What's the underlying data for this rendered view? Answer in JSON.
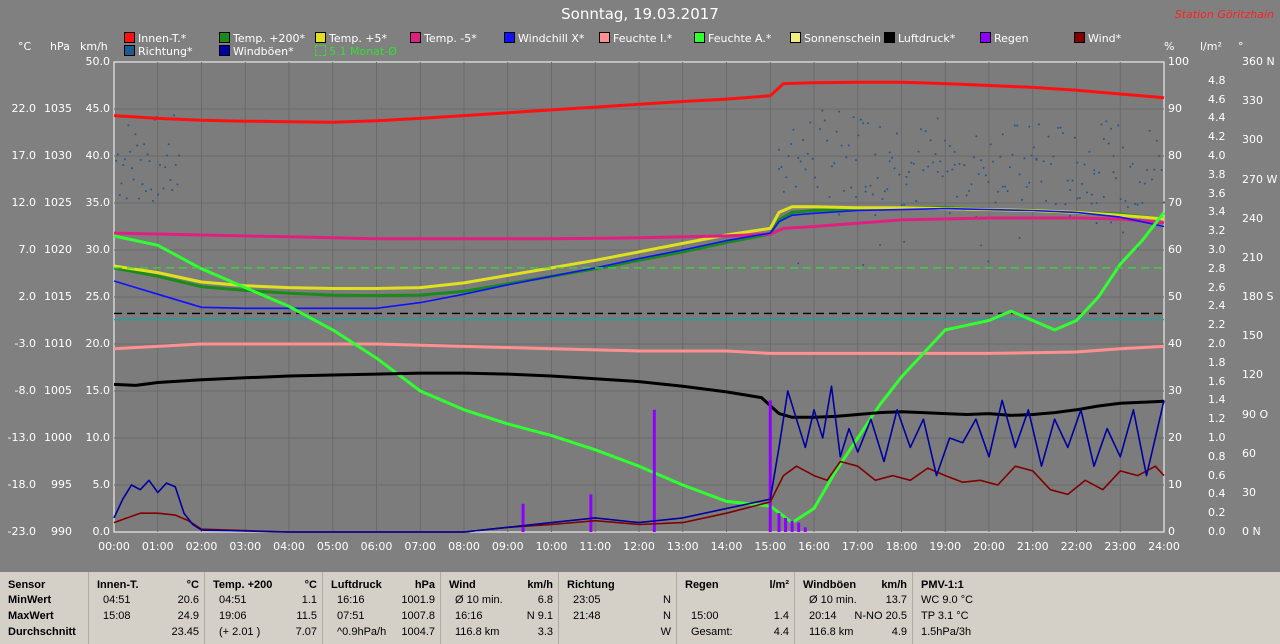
{
  "header": {
    "title": "Sonntag, 19.03.2017",
    "station": "Station Göritzhain"
  },
  "legend": [
    {
      "label": "Innen-T.*",
      "color": "#ff1010"
    },
    {
      "label": "Temp. +200*",
      "color": "#1a8a1a"
    },
    {
      "label": "Temp. +5*",
      "color": "#e0e020"
    },
    {
      "label": "Temp. -5*",
      "color": "#e02080"
    },
    {
      "label": "Windchill X*",
      "color": "#1010ff"
    },
    {
      "label": "Feuchte I.*",
      "color": "#ff9090"
    },
    {
      "label": "Feuchte A.*",
      "color": "#30ff30"
    },
    {
      "label": "Sonnenschein",
      "color": "#f0f080"
    },
    {
      "label": "Luftdruck*",
      "color": "#000000"
    },
    {
      "label": "Regen",
      "color": "#9000ff"
    },
    {
      "label": "Wind*",
      "color": "#800000"
    },
    {
      "label": "Richtung*",
      "color": "#205890"
    },
    {
      "label": "Windböen*",
      "color": "#0000a0"
    },
    {
      "label": "5.1 Monat-Ø",
      "color": "#30e030"
    }
  ],
  "units": {
    "c": "°C",
    "hpa": "hPa",
    "kmh": "km/h",
    "pct": "%",
    "lm2": "l/m²",
    "deg": "°"
  },
  "axes": {
    "temp_ticks": [
      "22.0",
      "17.0",
      "12.0",
      "7.0",
      "2.0",
      "-3.0",
      "-8.0",
      "-13.0",
      "-18.0",
      "-23.0"
    ],
    "hpa_ticks": [
      "1035",
      "1030",
      "1025",
      "1020",
      "1015",
      "1010",
      "1005",
      "1000",
      "995",
      "990"
    ],
    "kmh_ticks": [
      "50.0",
      "45.0",
      "40.0",
      "35.0",
      "30.0",
      "25.0",
      "20.0",
      "15.0",
      "10.0",
      "5.0",
      "0.0"
    ],
    "pct_ticks": [
      "100",
      "90",
      "80",
      "70",
      "60",
      "50",
      "40",
      "30",
      "20",
      "10",
      "0"
    ],
    "rain_ticks": [
      "4.8",
      "4.6",
      "4.4",
      "4.2",
      "4.0",
      "3.8",
      "3.6",
      "3.4",
      "3.2",
      "3.0",
      "2.8",
      "2.6",
      "2.4",
      "2.2",
      "2.0",
      "1.8",
      "1.6",
      "1.4",
      "1.2",
      "1.0",
      "0.8",
      "0.6",
      "0.4",
      "0.2",
      "0.0"
    ],
    "deg_ticks": [
      "360 N",
      "330",
      "300",
      "270 W",
      "240",
      "210",
      "180 S",
      "150",
      "120",
      "90 O",
      "60",
      "30",
      "0 N"
    ],
    "x_ticks": [
      "00:00",
      "01:00",
      "02:00",
      "03:00",
      "04:00",
      "05:00",
      "06:00",
      "07:00",
      "08:00",
      "09:00",
      "10:00",
      "11:00",
      "12:00",
      "13:00",
      "14:00",
      "15:00",
      "16:00",
      "17:00",
      "18:00",
      "19:00",
      "20:00",
      "21:00",
      "22:00",
      "23:00",
      "24:00"
    ]
  },
  "chart_data": {
    "type": "line",
    "x_unit": "hour",
    "series": [
      {
        "name": "Innen-T.*",
        "color": "#ff1010",
        "axis": "temp",
        "x": [
          0,
          1,
          2,
          3,
          4,
          5,
          6,
          7,
          8,
          9,
          10,
          11,
          12,
          13,
          14,
          15,
          15.3,
          16,
          17,
          18,
          19,
          20,
          21,
          22,
          23,
          24
        ],
        "values": [
          21.3,
          21.0,
          20.8,
          20.7,
          20.65,
          20.6,
          20.75,
          21.0,
          21.3,
          21.6,
          21.9,
          22.2,
          22.5,
          22.8,
          23.05,
          23.4,
          24.7,
          24.8,
          24.85,
          24.85,
          24.7,
          24.5,
          24.3,
          24.0,
          23.6,
          23.2
        ]
      },
      {
        "name": "Temp. +200*",
        "color": "#1a8a1a",
        "axis": "temp",
        "x": [
          0,
          1,
          2,
          3,
          4,
          5,
          6,
          7,
          8,
          9,
          10,
          11,
          12,
          13,
          14,
          15,
          15.2,
          15.5,
          16,
          17,
          18,
          19,
          20,
          21,
          22,
          23,
          24
        ],
        "values": [
          5.1,
          4.2,
          3.1,
          2.7,
          2.4,
          2.2,
          2.15,
          2.2,
          2.6,
          3.4,
          4.2,
          5.0,
          5.9,
          6.8,
          7.8,
          8.7,
          10.2,
          11.0,
          11.2,
          11.4,
          11.5,
          11.5,
          11.3,
          11.2,
          11.0,
          10.8,
          10.3
        ]
      },
      {
        "name": "Temp. +5*",
        "color": "#e0e020",
        "axis": "temp",
        "x": [
          0,
          1,
          2,
          3,
          4,
          5,
          6,
          7,
          8,
          9,
          10,
          11,
          12,
          13,
          14,
          15,
          15.2,
          15.5,
          16,
          17,
          18,
          19,
          20,
          21,
          22,
          23,
          24
        ],
        "values": [
          5.3,
          4.6,
          3.6,
          3.2,
          3.0,
          2.9,
          2.9,
          3.0,
          3.5,
          4.3,
          5.1,
          5.9,
          6.8,
          7.7,
          8.6,
          9.3,
          11.0,
          11.6,
          11.6,
          11.5,
          11.5,
          11.4,
          11.3,
          11.2,
          11.0,
          10.7,
          10.3
        ]
      },
      {
        "name": "Temp. -5*",
        "color": "#e02080",
        "axis": "temp",
        "x": [
          0,
          2,
          4,
          6,
          8,
          10,
          12,
          14,
          15,
          15.3,
          16,
          18,
          20,
          22,
          23,
          24
        ],
        "values": [
          8.8,
          8.6,
          8.4,
          8.2,
          8.2,
          8.2,
          8.3,
          8.5,
          8.7,
          9.3,
          9.5,
          10.2,
          10.4,
          10.4,
          10.3,
          9.9
        ]
      },
      {
        "name": "Windchill X*",
        "color": "#1010ff",
        "axis": "temp",
        "x": [
          0,
          1,
          2,
          3,
          4,
          5,
          6,
          7,
          8,
          9,
          10,
          11,
          12,
          13,
          14,
          15,
          15.2,
          15.5,
          16,
          17,
          18,
          19,
          20,
          21,
          22,
          23,
          24
        ],
        "values": [
          3.7,
          2.3,
          0.9,
          0.8,
          0.8,
          0.8,
          0.8,
          1.4,
          2.3,
          3.3,
          4.2,
          5.1,
          6.1,
          7.0,
          8.0,
          8.8,
          10.0,
          10.7,
          10.9,
          11.2,
          11.3,
          11.4,
          11.3,
          11.2,
          11.0,
          10.5,
          9.5
        ]
      },
      {
        "name": "Feuchte I.*",
        "color": "#ff9090",
        "axis": "pct",
        "x": [
          0,
          2,
          4,
          6,
          8,
          10,
          12,
          14,
          15,
          16,
          18,
          20,
          22,
          23,
          24
        ],
        "values": [
          39,
          40,
          40,
          40,
          39.5,
          39,
          38.5,
          38.5,
          38,
          38,
          38,
          38,
          38.3,
          39,
          39.5
        ]
      },
      {
        "name": "Feuchte A.*",
        "color": "#30ff30",
        "axis": "pct",
        "x": [
          0,
          1,
          2,
          3,
          4,
          5,
          6,
          7,
          8,
          9,
          10,
          11,
          12,
          13,
          14,
          15,
          15.5,
          16,
          16.5,
          17,
          17.5,
          18,
          18.5,
          19,
          19.5,
          20,
          20.5,
          21,
          21.5,
          22,
          22.5,
          23,
          23.5,
          24
        ],
        "values": [
          63,
          61,
          56,
          52,
          48,
          43,
          37,
          30,
          26,
          23,
          20.5,
          17.5,
          14,
          10,
          6.5,
          5.5,
          2,
          5,
          13,
          20,
          27,
          33,
          38,
          43,
          44,
          45,
          47,
          45,
          43,
          45,
          50,
          57,
          62,
          68
        ]
      },
      {
        "name": "Luftdruck*",
        "color": "#000000",
        "axis": "hpa",
        "x": [
          0,
          0.5,
          1,
          2,
          3,
          4,
          5,
          6,
          7,
          8,
          9,
          10,
          11,
          12,
          13,
          14,
          14.8,
          15.2,
          15.5,
          16,
          16.5,
          17,
          17.5,
          18,
          18.5,
          19,
          19.5,
          20,
          20.5,
          21,
          21.5,
          22,
          22.5,
          23,
          23.5,
          24
        ],
        "values": [
          1005.7,
          1005.6,
          1005.9,
          1006.2,
          1006.4,
          1006.6,
          1006.7,
          1006.8,
          1006.9,
          1006.9,
          1006.8,
          1006.6,
          1006.3,
          1006.0,
          1005.5,
          1004.9,
          1004.3,
          1002.6,
          1002.2,
          1002.2,
          1002.3,
          1002.5,
          1002.7,
          1002.8,
          1002.7,
          1002.6,
          1002.5,
          1002.6,
          1002.4,
          1002.5,
          1002.7,
          1003.0,
          1003.4,
          1003.7,
          1003.8,
          1003.9
        ]
      },
      {
        "name": "Regen",
        "color": "#9000ff",
        "axis": "rain",
        "type": "bar",
        "x": [
          9.35,
          10.9,
          12.35,
          15.0,
          15.2,
          15.35,
          15.5,
          15.65,
          15.8
        ],
        "values": [
          0.3,
          0.4,
          1.3,
          1.4,
          0.2,
          0.15,
          0.12,
          0.1,
          0.05
        ]
      },
      {
        "name": "Wind*",
        "color": "#800000",
        "axis": "kmh",
        "x": [
          0,
          0.3,
          0.6,
          1,
          1.4,
          1.7,
          2,
          4,
          6,
          8,
          9,
          10,
          11,
          12,
          13,
          14,
          15,
          15.3,
          15.6,
          16,
          16.3,
          16.6,
          17,
          17.4,
          17.8,
          18.2,
          18.6,
          19,
          19.4,
          19.8,
          20.2,
          20.6,
          21,
          21.4,
          21.8,
          22.2,
          22.6,
          23,
          23.4,
          23.8,
          24
        ],
        "values": [
          1.0,
          1.5,
          2.0,
          2.0,
          1.8,
          1.2,
          0.3,
          0,
          0,
          0,
          0.5,
          0.8,
          1.2,
          0.8,
          1.0,
          2.0,
          3.2,
          6.0,
          7.0,
          6.0,
          5.5,
          7.5,
          7.0,
          5.5,
          6.0,
          5.5,
          6.8,
          6.0,
          5.3,
          5.5,
          5.0,
          7.0,
          6.5,
          4.5,
          4.0,
          5.5,
          4.5,
          6.5,
          6.0,
          7.0,
          6.0
        ]
      },
      {
        "name": "Windböen*",
        "color": "#0000a0",
        "axis": "kmh",
        "x": [
          0,
          0.2,
          0.4,
          0.6,
          0.8,
          1,
          1.2,
          1.4,
          1.6,
          1.8,
          2,
          4,
          6,
          8,
          9,
          10,
          11,
          12,
          13,
          14,
          15,
          15.2,
          15.4,
          15.6,
          15.8,
          16,
          16.2,
          16.4,
          16.6,
          16.8,
          17,
          17.3,
          17.6,
          17.9,
          18.2,
          18.5,
          18.8,
          19.1,
          19.4,
          19.7,
          20,
          20.3,
          20.6,
          20.9,
          21.2,
          21.5,
          21.8,
          22.1,
          22.4,
          22.7,
          23,
          23.3,
          23.6,
          23.8,
          24
        ],
        "values": [
          1.5,
          3.5,
          5.0,
          4.5,
          5.5,
          4.2,
          5.2,
          4.8,
          2.0,
          0.8,
          0.2,
          0,
          0,
          0,
          0.5,
          1.0,
          1.5,
          1.0,
          1.5,
          2.5,
          3.5,
          9.0,
          15.0,
          12.0,
          9.0,
          13.0,
          10.0,
          15.5,
          8.0,
          11.0,
          8.5,
          12.0,
          7.5,
          13.0,
          9.0,
          12.0,
          6.0,
          10.0,
          9.5,
          12.0,
          8.0,
          14.0,
          9.0,
          13.0,
          7.0,
          12.0,
          9.0,
          13.0,
          7.0,
          11.0,
          8.0,
          13.0,
          6.0,
          10.0,
          14.0
        ]
      },
      {
        "name": "5.1 Monat-Ø",
        "color": "#30e030",
        "axis": "temp",
        "style": "dashed",
        "x": [
          0,
          24
        ],
        "values": [
          5.1,
          5.1
        ]
      }
    ],
    "reference_lines": [
      {
        "color": "#000000",
        "axis": "hpa",
        "value": 1013.25,
        "style": "dashed"
      },
      {
        "color": "#20a0a0",
        "axis": "hpa",
        "value": 1012.6,
        "style": "solid"
      }
    ],
    "xlim": [
      0,
      24
    ],
    "temp_ylim": [
      -23,
      27
    ],
    "hpa_ylim": [
      990,
      1040
    ],
    "kmh_ylim": [
      0,
      50
    ],
    "pct_ylim": [
      0,
      100
    ],
    "rain_ylim": [
      0,
      5
    ],
    "deg_ylim": [
      0,
      360
    ],
    "grid": true
  },
  "stats": {
    "row_labels": [
      "Sensor",
      "MinWert",
      "MaxWert",
      "Durchschnitt"
    ],
    "innen": {
      "title": "Innen-T.",
      "unit": "°C",
      "rows": [
        [
          "04:51",
          "20.6"
        ],
        [
          "15:08",
          "24.9"
        ],
        [
          "",
          "23.45"
        ]
      ]
    },
    "temp200": {
      "title": "Temp. +200",
      "unit": "°C",
      "rows": [
        [
          "04:51",
          "1.1"
        ],
        [
          "19:06",
          "11.5"
        ],
        [
          "(+ 2.01 )",
          "7.07"
        ]
      ]
    },
    "luftdruck": {
      "title": "Luftdruck",
      "unit": "hPa",
      "rows": [
        [
          "16:16",
          "1001.9"
        ],
        [
          "07:51",
          "1007.8"
        ],
        [
          "^0.9hPa/h",
          "1004.7"
        ]
      ]
    },
    "wind": {
      "title": "Wind",
      "unit": "km/h",
      "rows": [
        [
          "Ø 10 min.",
          "6.8"
        ],
        [
          "16:16",
          "N 9.1"
        ],
        [
          "116.8 km",
          "3.3"
        ]
      ]
    },
    "richtung": {
      "title": "Richtung",
      "rows": [
        [
          "23:05",
          "N"
        ],
        [
          "21:48",
          "N"
        ],
        [
          "",
          "W"
        ]
      ]
    },
    "regen": {
      "title": "Regen",
      "unit": "l/m²",
      "rows": [
        [
          "",
          ""
        ],
        [
          "15:00",
          "1.4"
        ],
        [
          "Gesamt:",
          "4.4"
        ]
      ]
    },
    "boeen": {
      "title": "Windböen",
      "unit": "km/h",
      "rows": [
        [
          "Ø 10 min.",
          "13.7"
        ],
        [
          "20:14",
          "N-NO 20.5"
        ],
        [
          "116.8 km",
          "4.9"
        ]
      ]
    },
    "pmv": {
      "title": "PMV-1:1",
      "rows": [
        "WC 9.0 °C",
        "TP 3.1 °C",
        "1.5hPa/3h"
      ]
    }
  }
}
